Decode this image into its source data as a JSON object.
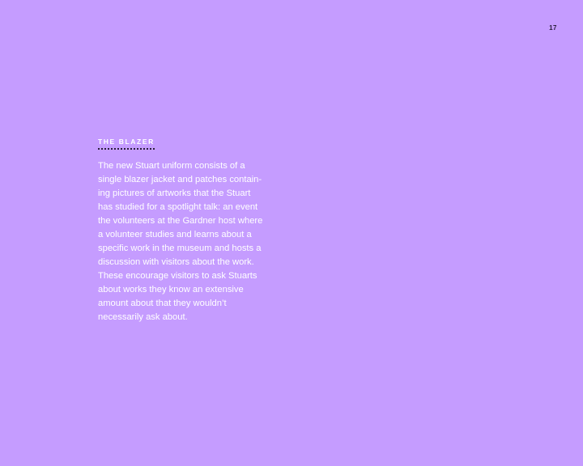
{
  "page": {
    "number": "17"
  },
  "section": {
    "heading": "THE BLAZER",
    "lines": [
      "The new Stuart uniform consists of a",
      "single blazer jacket and patches contain-",
      "ing pictures of artworks that the Stuart",
      "has studied for a spotlight talk: an event",
      "the volunteers at the Gardner host where",
      "a volunteer studies and learns about a",
      "specific work in the museum and hosts a",
      "discussion with visitors about the work.",
      "These encourage visitors to ask Stuarts",
      "about works they know an extensive",
      "amount about that they wouldn’t",
      "necessarily ask about."
    ]
  },
  "colors": {
    "background": "#c59cff",
    "text": "#ffffff",
    "page_number": "#2a1f3d"
  }
}
